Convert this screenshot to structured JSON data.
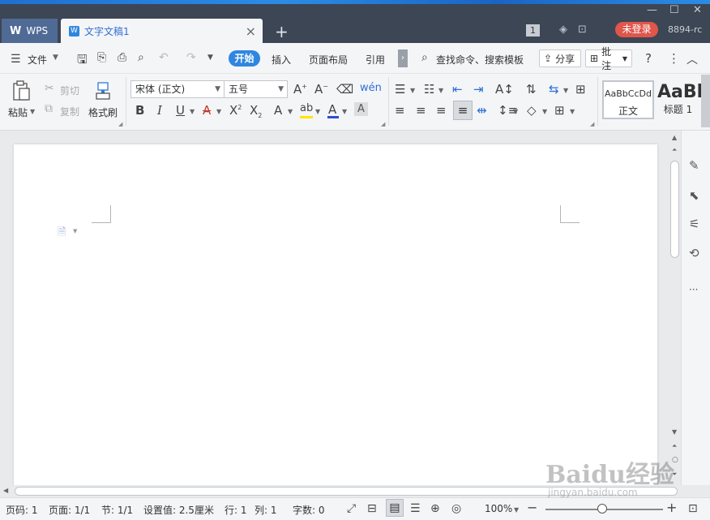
{
  "tabs": {
    "wps_label": "WPS",
    "doc_label": "文字文稿1"
  },
  "titlebar": {
    "badge_number": "1",
    "login_label": "未登录",
    "user_id": "8894-rc"
  },
  "menubar": {
    "file_label": "文件",
    "tabs": [
      "开始",
      "插入",
      "页面布局",
      "引用"
    ],
    "search_label": "查找命令、搜索模板",
    "share_label": "分享",
    "comment_label": "批注"
  },
  "ribbon": {
    "paste_label": "粘贴",
    "cut_label": "剪切",
    "copy_label": "复制",
    "format_painter_label": "格式刷",
    "font_name": "宋体 (正文)",
    "font_size": "五号",
    "style_normal_preview": "AaBbCcDd",
    "style_normal_label": "正文",
    "style_heading_preview": "AaBl",
    "style_heading_label": "标题 1"
  },
  "statusbar": {
    "page_code": "页码: 1",
    "page": "页面: 1/1",
    "section": "节: 1/1",
    "setting": "设置值: 2.5厘米",
    "row": "行: 1",
    "col": "列: 1",
    "word_count": "字数: 0",
    "zoom": "100%"
  },
  "watermark": {
    "main": "Baidu经验",
    "sub": "jingyan.baidu.com"
  },
  "colors": {
    "titlebar": "#3d4654",
    "accent": "#2f86e0",
    "login": "#e0564b",
    "font_color_bar": "#2b4fd4",
    "highlight_bar": "#ffe600"
  }
}
